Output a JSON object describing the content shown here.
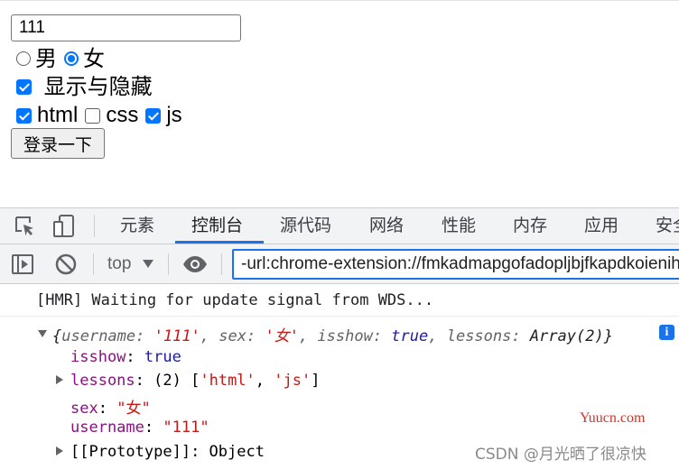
{
  "form": {
    "text_value": "111",
    "gender_options": [
      {
        "label": "男",
        "checked": false
      },
      {
        "label": "女",
        "checked": true
      }
    ],
    "toggle": {
      "label": " 显示与隐藏",
      "checked": true
    },
    "lessons": [
      {
        "label": "html",
        "checked": true
      },
      {
        "label": "css",
        "checked": false
      },
      {
        "label": "js",
        "checked": true
      }
    ],
    "login_button_label": "登录一下"
  },
  "devtools": {
    "tabs": [
      "元素",
      "控制台",
      "源代码",
      "网络",
      "性能",
      "内存",
      "应用",
      "安全"
    ],
    "active_tab_index": 1,
    "context_selector": "top",
    "filter_text": "-url:chrome-extension://fmkadmapgofadopljbjfkapdkoienihi"
  },
  "console": {
    "log_line": "[HMR] Waiting for update signal from WDS...",
    "object_summary": {
      "open_brace": "{",
      "username_key": "username: ",
      "username_value": "'111'",
      "sex_key": ", sex: ",
      "sex_value": "'女'",
      "isshow_key": ", isshow: ",
      "isshow_value": "true",
      "lessons_key": ", lessons: ",
      "lessons_value": "Array(2)",
      "close_brace": "}"
    },
    "info_badge": "i",
    "properties": {
      "isshow_key": "isshow",
      "isshow_value": "true",
      "lessons_key": "lessons",
      "lessons_count": "(2)",
      "lessons_open": "[",
      "lessons_item1": "'html'",
      "lessons_comma": ", ",
      "lessons_item2": "'js'",
      "lessons_close": "]",
      "sex_key": "sex",
      "sex_value": "\"女\"",
      "username_key": "username",
      "username_value": "\"111\"",
      "prototype_key": "[[Prototype]]",
      "prototype_value": "Object"
    }
  },
  "watermarks": {
    "site": "Yuucn.com",
    "author": "CSDN @月光晒了很凉快"
  },
  "colors": {
    "accent": "#1a73e8",
    "checkbox": "#0075ff",
    "property": "#881280",
    "string": "#c41a16",
    "keyword": "#1a1aa6"
  },
  "icons": [
    "inspect-element-icon",
    "device-toolbar-icon",
    "sidebar-toggle-icon",
    "clear-console-icon",
    "eye-icon",
    "dropdown-arrow-icon"
  ]
}
